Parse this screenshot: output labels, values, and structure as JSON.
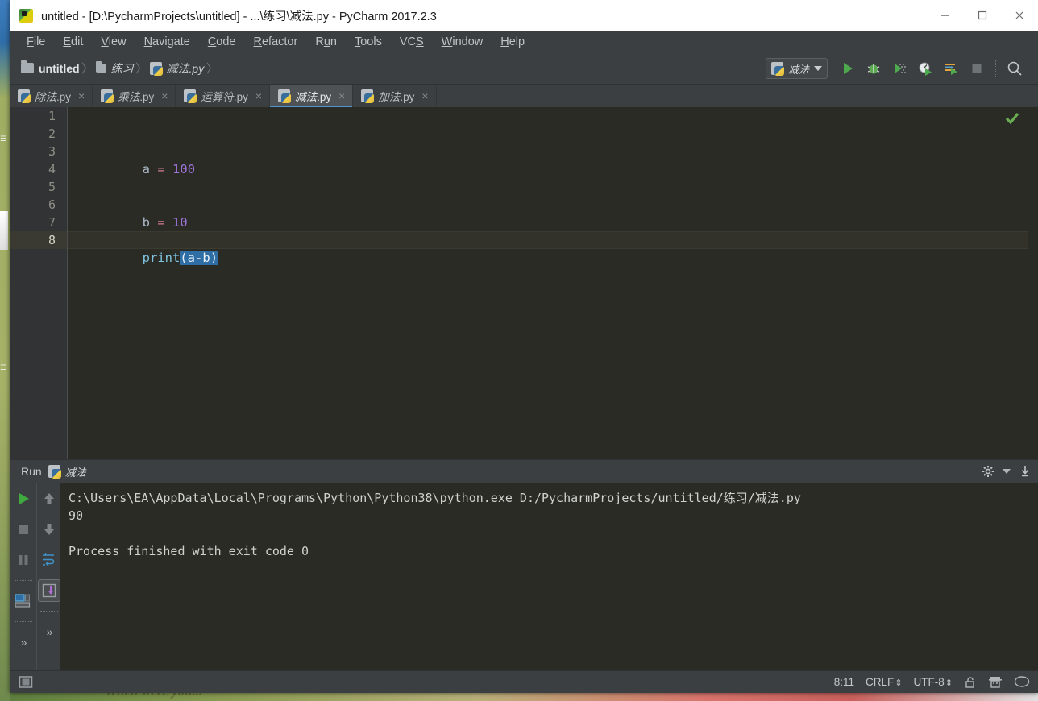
{
  "window": {
    "title": "untitled - [D:\\PycharmProjects\\untitled] - ...\\练习\\减法.py - PyCharm 2017.2.3",
    "app_icon": "pycharm-icon",
    "controls": {
      "minimize": "minimize-icon",
      "maximize": "maximize-icon",
      "close": "close-icon"
    }
  },
  "menubar": {
    "items": [
      {
        "pre": "",
        "mn": "F",
        "post": "ile"
      },
      {
        "pre": "",
        "mn": "E",
        "post": "dit"
      },
      {
        "pre": "",
        "mn": "V",
        "post": "iew"
      },
      {
        "pre": "",
        "mn": "N",
        "post": "avigate"
      },
      {
        "pre": "",
        "mn": "C",
        "post": "ode"
      },
      {
        "pre": "",
        "mn": "R",
        "post": "efactor"
      },
      {
        "pre": "R",
        "mn": "u",
        "post": "n"
      },
      {
        "pre": "",
        "mn": "T",
        "post": "ools"
      },
      {
        "pre": "VC",
        "mn": "S",
        "post": ""
      },
      {
        "pre": "",
        "mn": "W",
        "post": "indow"
      },
      {
        "pre": "",
        "mn": "H",
        "post": "elp"
      }
    ]
  },
  "breadcrumb": {
    "items": [
      {
        "label": "untitled",
        "icon": "folder-icon"
      },
      {
        "label": "练习",
        "icon": "folder-icon"
      },
      {
        "label": "减法.py",
        "icon": "python-file-icon"
      }
    ],
    "separator": "〉"
  },
  "run_toolbar": {
    "config_name": "减法",
    "config_icon": "python-run-config-icon",
    "dropdown_icon": "chevron-down-icon",
    "buttons": [
      {
        "name": "run-button",
        "icon": "run-icon"
      },
      {
        "name": "debug-button",
        "icon": "debug-bug-icon"
      },
      {
        "name": "coverage-button",
        "icon": "coverage-icon"
      },
      {
        "name": "profile-button",
        "icon": "profile-icon"
      },
      {
        "name": "run-with-console-button",
        "icon": "run-console-icon"
      },
      {
        "name": "stop-button",
        "icon": "stop-icon"
      },
      {
        "name": "search-everywhere-button",
        "icon": "search-icon"
      }
    ]
  },
  "tabs": [
    {
      "label": "除法",
      "ext": ".py",
      "active": false,
      "close": "×"
    },
    {
      "label": "乘法",
      "ext": ".py",
      "active": false,
      "close": "×"
    },
    {
      "label": "运算符",
      "ext": ".py",
      "active": false,
      "close": "×"
    },
    {
      "label": "减法",
      "ext": ".py",
      "active": true,
      "close": "×"
    },
    {
      "label": "加法",
      "ext": ".py",
      "active": false,
      "close": "×"
    }
  ],
  "editor": {
    "line_numbers": [
      "1",
      "2",
      "3",
      "4",
      "5",
      "6",
      "7",
      "8"
    ],
    "current_line": 8,
    "lines": [
      {
        "n": 1,
        "text": ""
      },
      {
        "n": 2,
        "text": ""
      },
      {
        "n": 3,
        "text": "a = 100"
      },
      {
        "n": 4,
        "text": ""
      },
      {
        "n": 5,
        "text": ""
      },
      {
        "n": 6,
        "text": "b = 10"
      },
      {
        "n": 7,
        "text": ""
      },
      {
        "n": 8,
        "text": "print(a-b)"
      }
    ],
    "tokens": {
      "l3": {
        "var": "a",
        "op": "=",
        "num": "100"
      },
      "l6": {
        "var": "b",
        "op": "=",
        "num": "10"
      },
      "l8": {
        "fn": "print",
        "open": "(",
        "a": "a",
        "minus": "-",
        "b": "b",
        "close": ")"
      }
    },
    "inspection_status": "ok-check-icon"
  },
  "run_panel": {
    "header_label": "Run",
    "header_name": "减法",
    "header_icon": "python-icon",
    "gear_icon": "gear-icon",
    "gear_dropdown_icon": "chevron-down-icon",
    "export_icon": "export-to-file-icon",
    "left_tools": [
      {
        "name": "rerun-button",
        "icon": "rerun-icon"
      },
      {
        "name": "stop-process-button",
        "icon": "stop-icon"
      },
      {
        "name": "pause-output-button",
        "icon": "pause-icon"
      },
      {
        "name": "console-layout-button",
        "icon": "console-view-icon"
      },
      {
        "name": "more-tools-button",
        "icon": "chevrons-right-icon"
      }
    ],
    "right_tools": [
      {
        "name": "up-stack-trace-button",
        "icon": "arrow-up-icon"
      },
      {
        "name": "down-stack-trace-button",
        "icon": "arrow-down-icon"
      },
      {
        "name": "soft-wrap-button",
        "icon": "soft-wrap-icon"
      },
      {
        "name": "scroll-to-end-button",
        "icon": "scroll-to-end-icon"
      },
      {
        "name": "more-tools-button-2",
        "icon": "chevrons-right-icon"
      }
    ],
    "console_lines": [
      "C:\\Users\\EA\\AppData\\Local\\Programs\\Python\\Python38\\python.exe D:/PycharmProjects/untitled/练习/减法.py",
      "90",
      "",
      "Process finished with exit code 0"
    ],
    "console_text": "C:\\Users\\EA\\AppData\\Local\\Programs\\Python\\Python38\\python.exe D:/PycharmProjects/untitled/练习/减法.py\n90\n\nProcess finished with exit code 0"
  },
  "statusbar": {
    "toggle_tool_window_icon": "toggle-tool-window-icon",
    "caret_position": "8:11",
    "line_separator": "CRLF",
    "encoding": "UTF-8",
    "spinner": "⇕",
    "lock_icon": "lock-icon",
    "inspector_icon": "hector-inspector-icon",
    "bubble_icon": "event-log-icon"
  },
  "desktop": {
    "wallpaper_text": "When were you...",
    "icon_a": "☰",
    "icon_c": "☰"
  },
  "colors": {
    "accent_blue": "#4e94ce",
    "selection_blue": "#2f6ea5",
    "run_green": "#4ea84e",
    "editor_bg": "#2b2b26",
    "panel_bg": "#3c3f41",
    "gutter_bg": "#313335",
    "keyword_pink": "#d17b8f",
    "number_purple": "#9d74d8",
    "function_cyan": "#7ec4e0"
  }
}
